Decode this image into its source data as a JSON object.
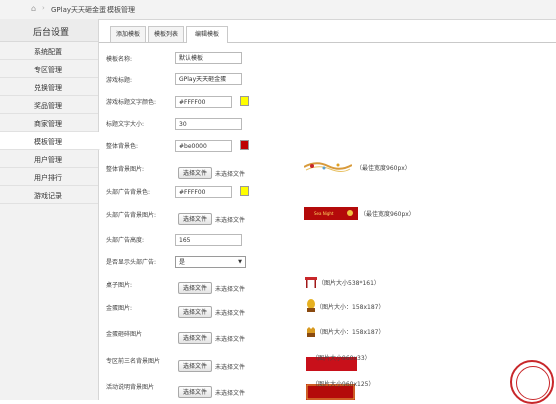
{
  "breadcrumb": {
    "home_icon": "home-icon",
    "app": "GPlay天天砸金蛋",
    "page": "模板管理"
  },
  "sidebar": {
    "title": "后台设置",
    "items": [
      {
        "label": "系统配置"
      },
      {
        "label": "专区管理"
      },
      {
        "label": "兑换管理"
      },
      {
        "label": "奖品管理"
      },
      {
        "label": "商家管理"
      },
      {
        "label": "模板管理",
        "active": true
      },
      {
        "label": "用户管理"
      },
      {
        "label": "用户排行"
      },
      {
        "label": "游戏记录"
      }
    ]
  },
  "tabs": [
    {
      "label": "添加模板"
    },
    {
      "label": "模板列表"
    },
    {
      "label": "编辑模板",
      "active": true
    }
  ],
  "form": {
    "template_name": {
      "label": "模板名称:",
      "value": "默认模板"
    },
    "game_title": {
      "label": "游戏标题:",
      "value": "GPlay天天砸金蛋"
    },
    "title_color": {
      "label": "游戏标题文字颜色:",
      "value": "#FFFF00",
      "swatch": "#FFFF00"
    },
    "title_size": {
      "label": "标题文字大小:",
      "value": "30"
    },
    "bg_color": {
      "label": "整体背景色:",
      "value": "#be0000",
      "swatch": "#be0000"
    },
    "bg_image": {
      "label": "整体背景图片:",
      "hint": "（最佳宽度960px）"
    },
    "header_bg_color": {
      "label": "头部广告背景色:",
      "value": "#FFFF00",
      "swatch": "#FFFF00"
    },
    "header_bg_image": {
      "label": "头部广告背景图片:",
      "hint": "（最佳宽度960px）"
    },
    "header_height": {
      "label": "头部广告高度:",
      "value": "165"
    },
    "show_header": {
      "label": "是否显示头部广告:",
      "value": "是"
    },
    "table_image": {
      "label": "桌子图片:",
      "hint": "（图片大小538*161）"
    },
    "gold_egg_image": {
      "label": "金蛋图片:",
      "hint": "（图片大小：158x187）"
    },
    "broken_egg_image": {
      "label": "金蛋砸碎图片",
      "hint": "（图片大小：158x187）"
    },
    "top3_bg_image": {
      "label": "专区前三名背景图片",
      "hint": "（图片大小960x33）"
    },
    "activity_bg_image": {
      "label": "活动说明背景图片",
      "hint": "（图片大小960x125）"
    }
  },
  "file_button_label": "选择文件",
  "no_file_label": "未选择文件",
  "stamp_text": "工作室",
  "colors": {
    "accent_red": "#be0000",
    "yellow": "#FFFF00"
  }
}
